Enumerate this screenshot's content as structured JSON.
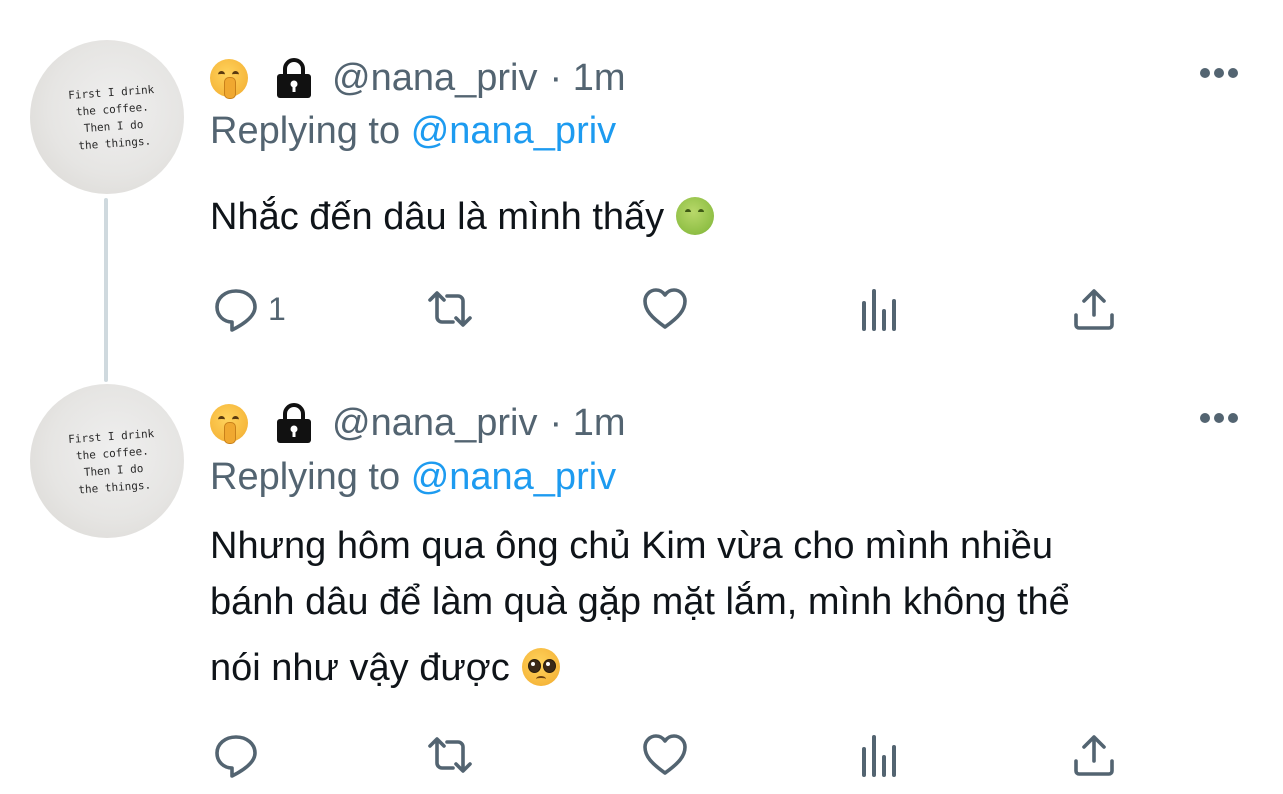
{
  "colors": {
    "accent": "#1d9bf0",
    "secondary_text": "#536471",
    "primary_text": "#0f1419",
    "thread_line": "#cfd9de"
  },
  "tweets": [
    {
      "avatar_text": "First I drink\nthe coffee.\nThen I do\nthe things.",
      "status_emoji": "shushing-face",
      "lock_icon": "lock-icon",
      "handle": "@nana_priv",
      "time": "· 1m",
      "replying_prefix": "Replying to",
      "replying_to": "@nana_priv",
      "text": "Nhắc đến dâu là mình thấy",
      "trailing_emoji": "nauseated-face",
      "reply_count": "1",
      "actions": [
        "reply-icon",
        "retweet-icon",
        "like-icon",
        "analytics-icon",
        "share-icon"
      ]
    },
    {
      "avatar_text": "First I drink\nthe coffee.\nThen I do\nthe things.",
      "status_emoji": "shushing-face",
      "lock_icon": "lock-icon",
      "handle": "@nana_priv",
      "time": "· 1m",
      "replying_prefix": "Replying to",
      "replying_to": "@nana_priv",
      "text_lines": [
        "Nhưng hôm qua ông chủ Kim vừa cho mình nhiều",
        "bánh dâu để làm quà gặp mặt lắm, mình không thể",
        "nói như vậy được"
      ],
      "trailing_emoji": "pleading-face",
      "reply_count": "",
      "actions": [
        "reply-icon",
        "retweet-icon",
        "like-icon",
        "analytics-icon",
        "share-icon"
      ]
    }
  ]
}
